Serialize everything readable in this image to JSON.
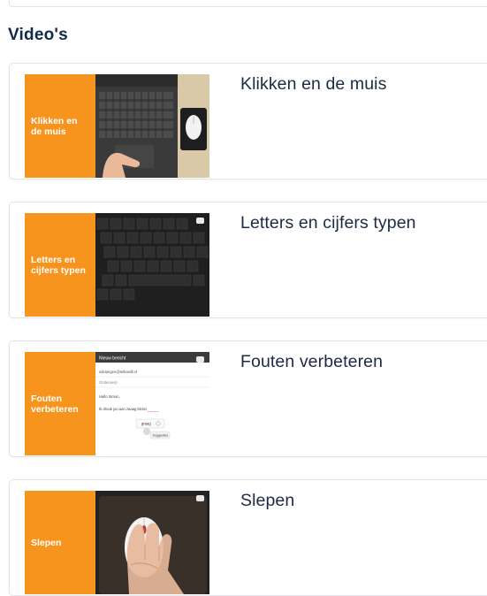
{
  "section": {
    "title": "Video's"
  },
  "videos": [
    {
      "thumb_label": "Klikken en\nde muis",
      "title": "Klikken en de muis"
    },
    {
      "thumb_label": "Letters en\ncijfers typen",
      "title": "Letters en cijfers typen"
    },
    {
      "thumb_label": "Fouten\nverbeteren",
      "title": "Fouten verbeteren",
      "email": {
        "header": "Nieuw bericht",
        "to": "sdelangen@telbanilk.nl",
        "subject": "Onderwerp",
        "greeting": "Hallo Simon,",
        "body": "Ik drouk jou aan zaaag kleinz",
        "suggestion_word": "graag",
        "suggestions_label": "Suggesties"
      }
    },
    {
      "thumb_label": "Slepen",
      "title": "Slepen"
    }
  ],
  "colors": {
    "accent": "#f7941d",
    "heading": "#0f2a4a",
    "title": "#1c2b44",
    "border": "#e2e4e8"
  }
}
